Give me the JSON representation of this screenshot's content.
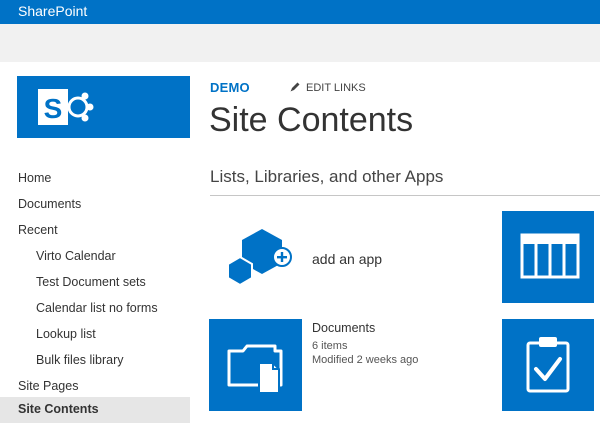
{
  "suite_bar": {
    "brand": "SharePoint"
  },
  "top_nav": {
    "site_link": "DEMO",
    "edit_links": "EDIT LINKS"
  },
  "page": {
    "title": "Site Contents",
    "section_title": "Lists, Libraries, and other Apps"
  },
  "left_nav": {
    "items": [
      {
        "label": "Home",
        "level": 1
      },
      {
        "label": "Documents",
        "level": 1
      },
      {
        "label": "Recent",
        "level": 1
      },
      {
        "label": "Virto Calendar",
        "level": 2
      },
      {
        "label": "Test Document sets",
        "level": 2
      },
      {
        "label": "Calendar list no forms",
        "level": 2
      },
      {
        "label": "Lookup list",
        "level": 2
      },
      {
        "label": "Bulk files library",
        "level": 2
      },
      {
        "label": "Site Pages",
        "level": 1
      },
      {
        "label": "Site Contents",
        "level": 1,
        "selected": true
      }
    ]
  },
  "apps": {
    "add_app_label": "add an app",
    "documents": {
      "name": "Documents",
      "item_count": "6 items",
      "modified": "Modified 2 weeks ago"
    }
  },
  "colors": {
    "brand_blue": "#0072c6",
    "ribbon_gray": "#f1f1f1",
    "selected_nav": "#e6e6e6"
  },
  "icons": [
    "sharepoint-logo-icon",
    "pencil-icon",
    "add-app-icon",
    "calendar-list-icon",
    "document-library-icon",
    "task-list-icon"
  ]
}
